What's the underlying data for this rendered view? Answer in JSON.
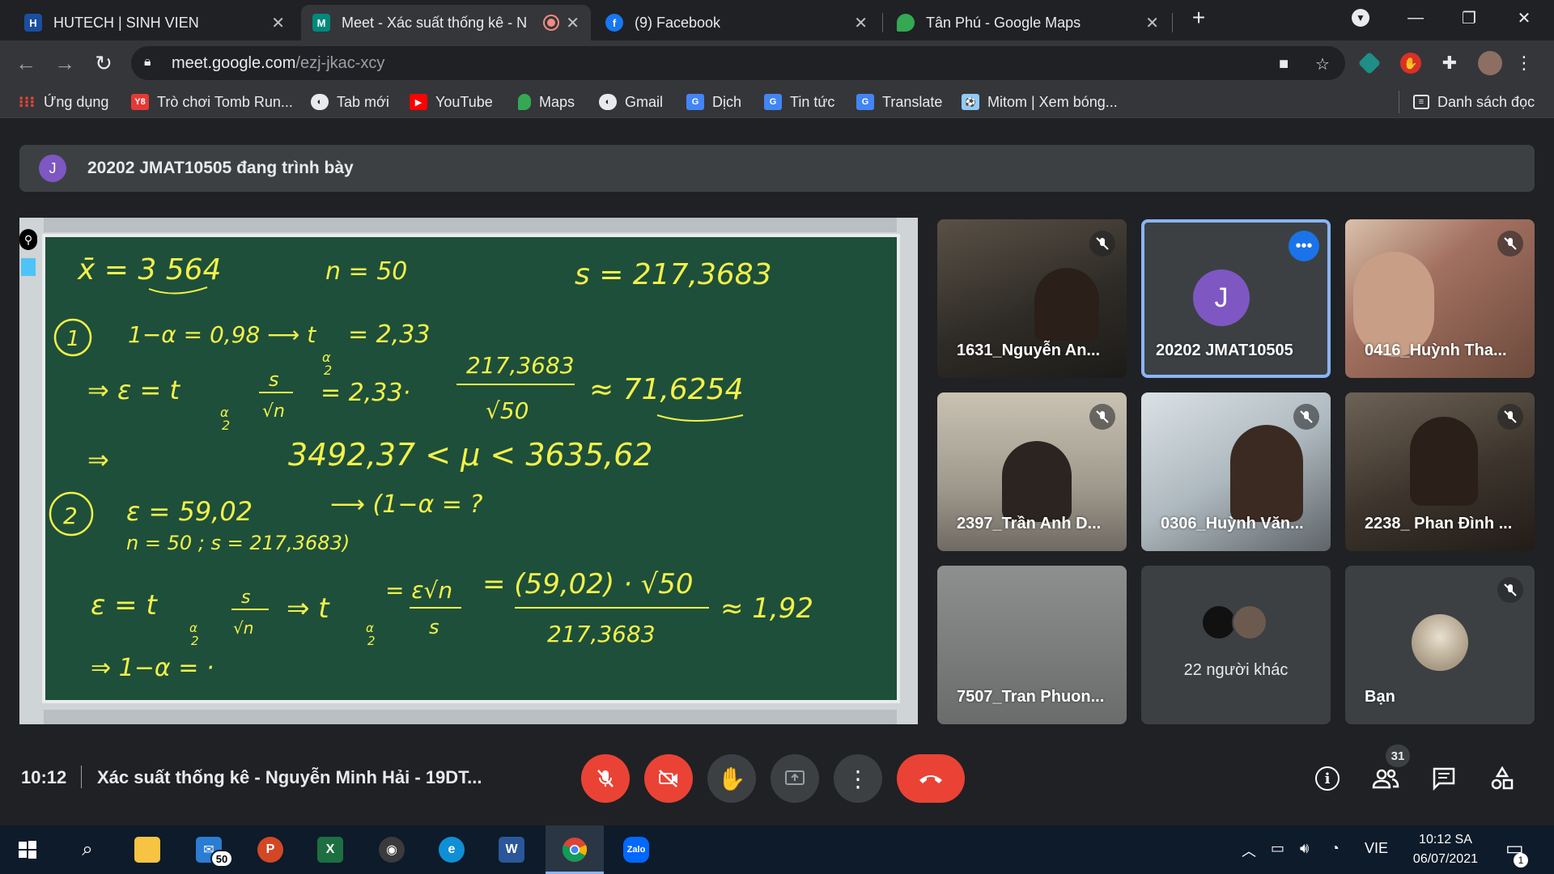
{
  "browser": {
    "tabs": [
      {
        "label": "HUTECH | SINH VIEN",
        "active": false
      },
      {
        "label": "Meet - Xác suất thống kê - N",
        "active": true
      },
      {
        "label": "(9) Facebook",
        "active": false
      },
      {
        "label": "Tân Phú - Google Maps",
        "active": false
      }
    ],
    "url_host": "meet.google.com",
    "url_path": "/ezj-jkac-xcy",
    "bookmarks": [
      "Ứng dụng",
      "Trò chơi Tomb Run...",
      "Tab mới",
      "YouTube",
      "Maps",
      "Gmail",
      "Dịch",
      "Tin tức",
      "Translate",
      "Mitom | Xem bóng..."
    ],
    "reading_list": "Danh sách đọc"
  },
  "meet": {
    "presenter_initial": "J",
    "presenter_banner": "20202 JMAT10505 đang trình bày",
    "board_lines": {
      "l1a": "x̄ = 3 564",
      "l1b": "n = 50",
      "l1c": "s = 217,3683",
      "l2num": "1",
      "l2": "1−α = 0,98  ⟶ t",
      "l2b": "= 2,33",
      "l3": "⇒ ε = t",
      "l3b": "s",
      "l3c": "√n",
      "l3d": "= 2,33·",
      "l3e": "217,3683",
      "l3f": "√50",
      "l3g": "≈ 71,6254",
      "l4a": "⇒",
      "l4": "3492,37 < μ < 3635,62",
      "l5num": "2",
      "l5": "ε = 59,02",
      "l5b": "⟶ (1−α = ?",
      "l6": "n = 50 ; s = 217,3683)",
      "l7": "ε = t",
      "l7b": "⇒ t",
      "l7c": "= ε√n",
      "l7c2": "s",
      "l7d": "= (59,02) · √50",
      "l7e": "217,3683",
      "l7f": "≈ 1,92",
      "l8": "⇒ 1−α = ·",
      "frac_a": "α",
      "frac_2": "2"
    },
    "participants": [
      {
        "name": "1631_Nguyễn An...",
        "muted": true
      },
      {
        "name": "20202 JMAT10505",
        "initial": "J",
        "speaking": true
      },
      {
        "name": "0416_Huỳnh Tha...",
        "muted": true
      },
      {
        "name": "2397_Trần Anh D...",
        "muted": true
      },
      {
        "name": "0306_Huỳnh Văn...",
        "muted": true
      },
      {
        "name": "2238_ Phan Đình ...",
        "muted": true
      },
      {
        "name": "7507_Tran Phuon...",
        "muted": false
      },
      {
        "name": "22 người khác"
      },
      {
        "name": "Bạn",
        "muted": true
      }
    ],
    "time": "10:12",
    "meeting_title": "Xác suất thống kê - Nguyễn Minh Hải - 19DT...",
    "people_count": "31"
  },
  "taskbar": {
    "mail_count": "50",
    "lang": "VIE",
    "time": "10:12 SA",
    "date": "06/07/2021",
    "notif": "1"
  },
  "colors": {
    "board": "#1e4f3a",
    "chalk": "#f3f14a",
    "danger": "#ea4335",
    "accent": "#8ab4f8",
    "avatar": "#7e57c2"
  }
}
